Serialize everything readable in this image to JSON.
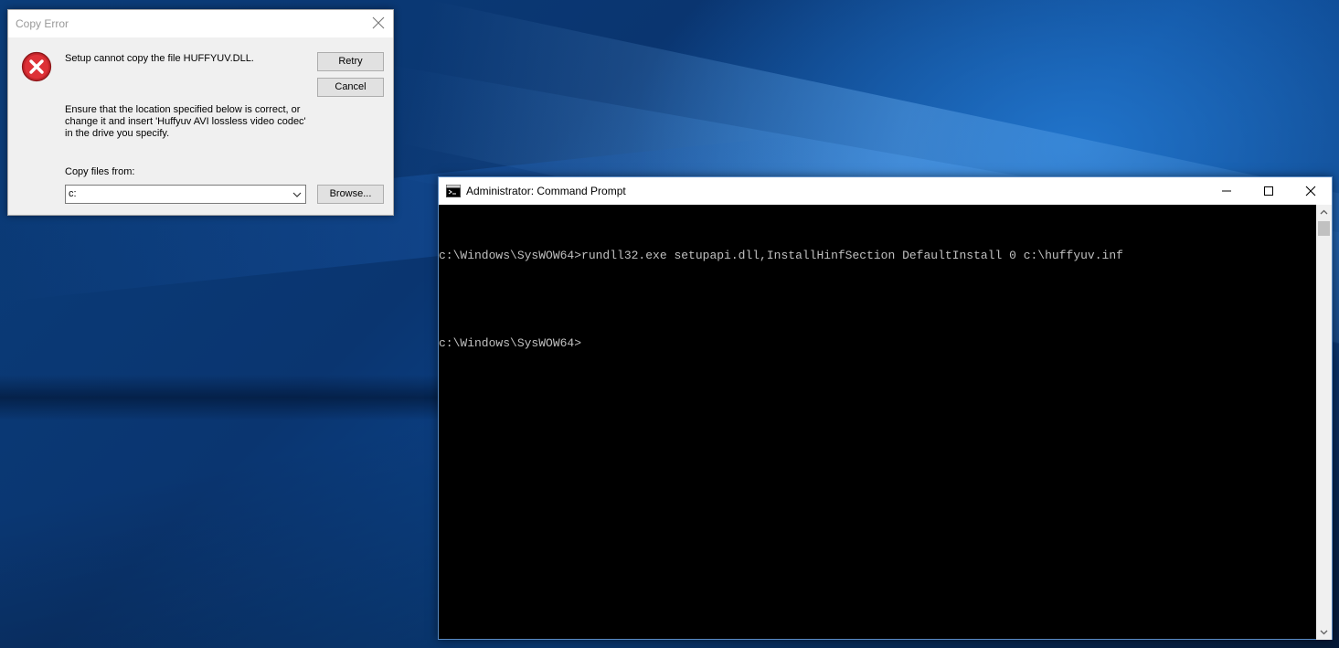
{
  "dialog": {
    "title": "Copy Error",
    "message": "Setup cannot copy the file HUFFYUV.DLL.",
    "info_line1": "Ensure that the location specified below is correct, or",
    "info_line2": "change it and insert 'Huffyuv AVI lossless video codec'",
    "info_line3": "in the drive you specify.",
    "copy_from_label": "Copy files from:",
    "copy_from_value": "c:",
    "retry_label": "Retry",
    "cancel_label": "Cancel",
    "browse_label": "Browse..."
  },
  "cmd": {
    "title": "Administrator: Command Prompt",
    "lines": [
      "c:\\Windows\\SysWOW64>rundll32.exe setupapi.dll,InstallHinfSection DefaultInstall 0 c:\\huffyuv.inf",
      "",
      "c:\\Windows\\SysWOW64>"
    ]
  },
  "colors": {
    "console_text": "#c0c0c0",
    "console_bg": "#000000",
    "error_red": "#d9252b"
  }
}
